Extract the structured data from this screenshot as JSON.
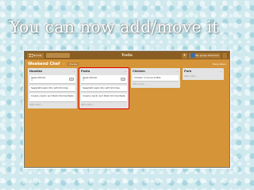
{
  "banner": {
    "title": "You can now add/move it"
  },
  "topbar": {
    "boards_label": "Boards",
    "logo": "Trello",
    "plus": "+",
    "user_label": "Ms. Jacqui Montclair"
  },
  "board": {
    "name": "Weekend Chef",
    "star": "☆",
    "private_label": "Private",
    "show_menu": "Show Menu"
  },
  "lists": [
    {
      "title": "Noodles",
      "cards": [
        {
          "title": "Jajaia Alfredo",
          "sub": "≡"
        },
        {
          "title": "Spaghetti Aglio Olio with Shrimps",
          "sub": ""
        },
        {
          "title": "Creamy Garlic and Pesto Shrimp Pasta",
          "sub": ""
        }
      ],
      "add_label": "Add a card..."
    },
    {
      "title": "Pasta",
      "cards": [
        {
          "title": "Jajaia Alfredo",
          "sub": "≡"
        },
        {
          "title": "Spaghetti Aglio Olio with Shrimps",
          "sub": ""
        },
        {
          "title": "Creamy Garlic and Pesto Shrimp Pasta",
          "sub": ""
        }
      ],
      "add_label": "Add a card..."
    },
    {
      "title": "Chicken",
      "cards": [
        {
          "title": "Chicken in Coconut Milk",
          "sub": ""
        }
      ],
      "add_label": "Add a card..."
    },
    {
      "title": "Pork",
      "cards": [],
      "add_label": "Add a card..."
    }
  ],
  "colors": {
    "board_bg": "#d49437",
    "highlight": "#e60000"
  }
}
